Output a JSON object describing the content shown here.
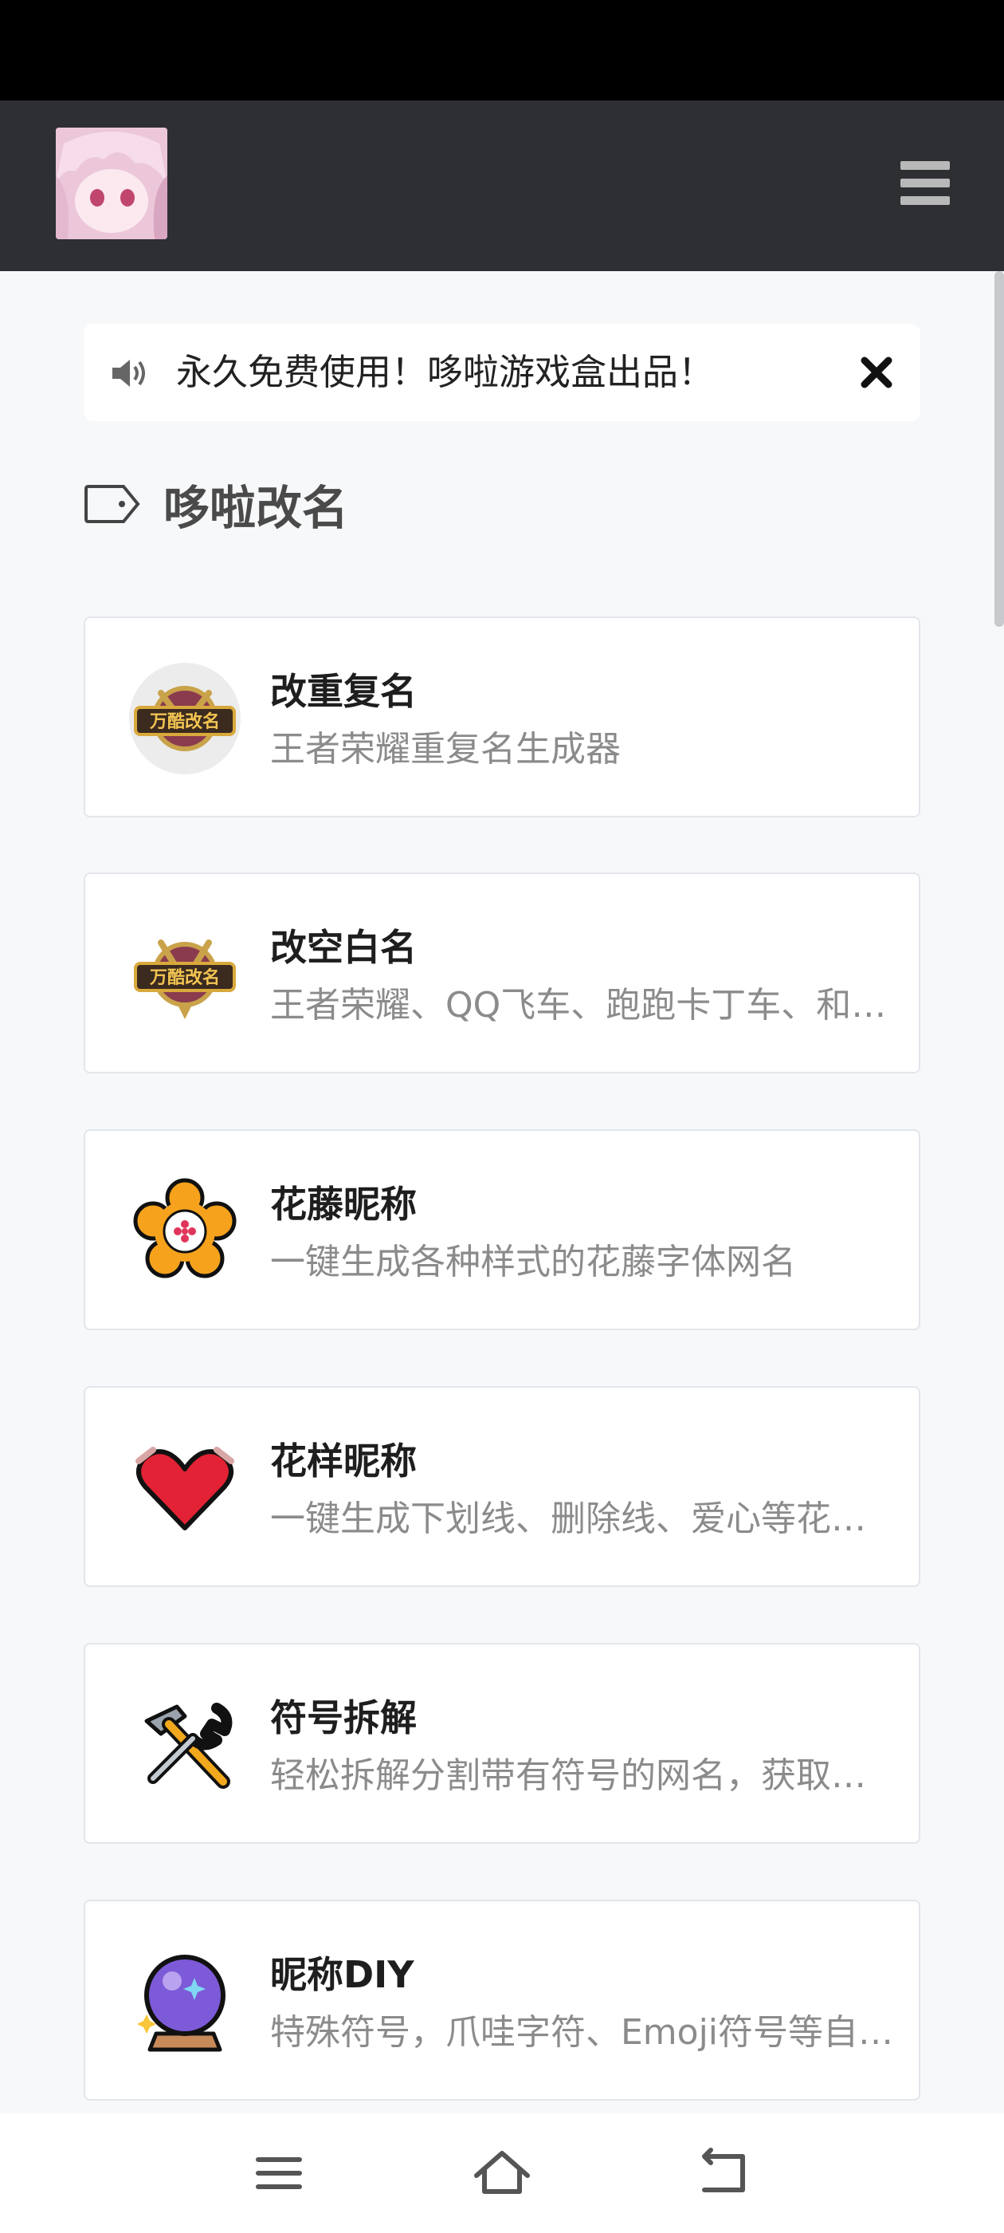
{
  "notice": {
    "text": "永久免费使用！哆啦游戏盒出品！"
  },
  "section": {
    "title": "哆啦改名"
  },
  "cards": [
    {
      "title": "改重复名",
      "desc": "王者荣耀重复名生成器",
      "icon": "game-logo-icon"
    },
    {
      "title": "改空白名",
      "desc": "王者荣耀、QQ飞车、跑跑卡丁车、和平精英",
      "icon": "game-logo-icon"
    },
    {
      "title": "花藤昵称",
      "desc": "一键生成各种样式的花藤字体网名",
      "icon": "flower-icon"
    },
    {
      "title": "花样昵称",
      "desc": "一键生成下划线、删除线、爱心等花样昵称",
      "icon": "heart-icon"
    },
    {
      "title": "符号拆解",
      "desc": "轻松拆解分割带有符号的网名，获取单个符号",
      "icon": "tools-icon"
    },
    {
      "title": "昵称DIY",
      "desc": "特殊符号，爪哇字符、Emoji符号等自由组合",
      "icon": "crystal-ball-icon"
    }
  ],
  "colors": {
    "header_bg": "#2d2f33",
    "page_bg": "#f7f8f9",
    "card_border": "#e2e6ea"
  }
}
